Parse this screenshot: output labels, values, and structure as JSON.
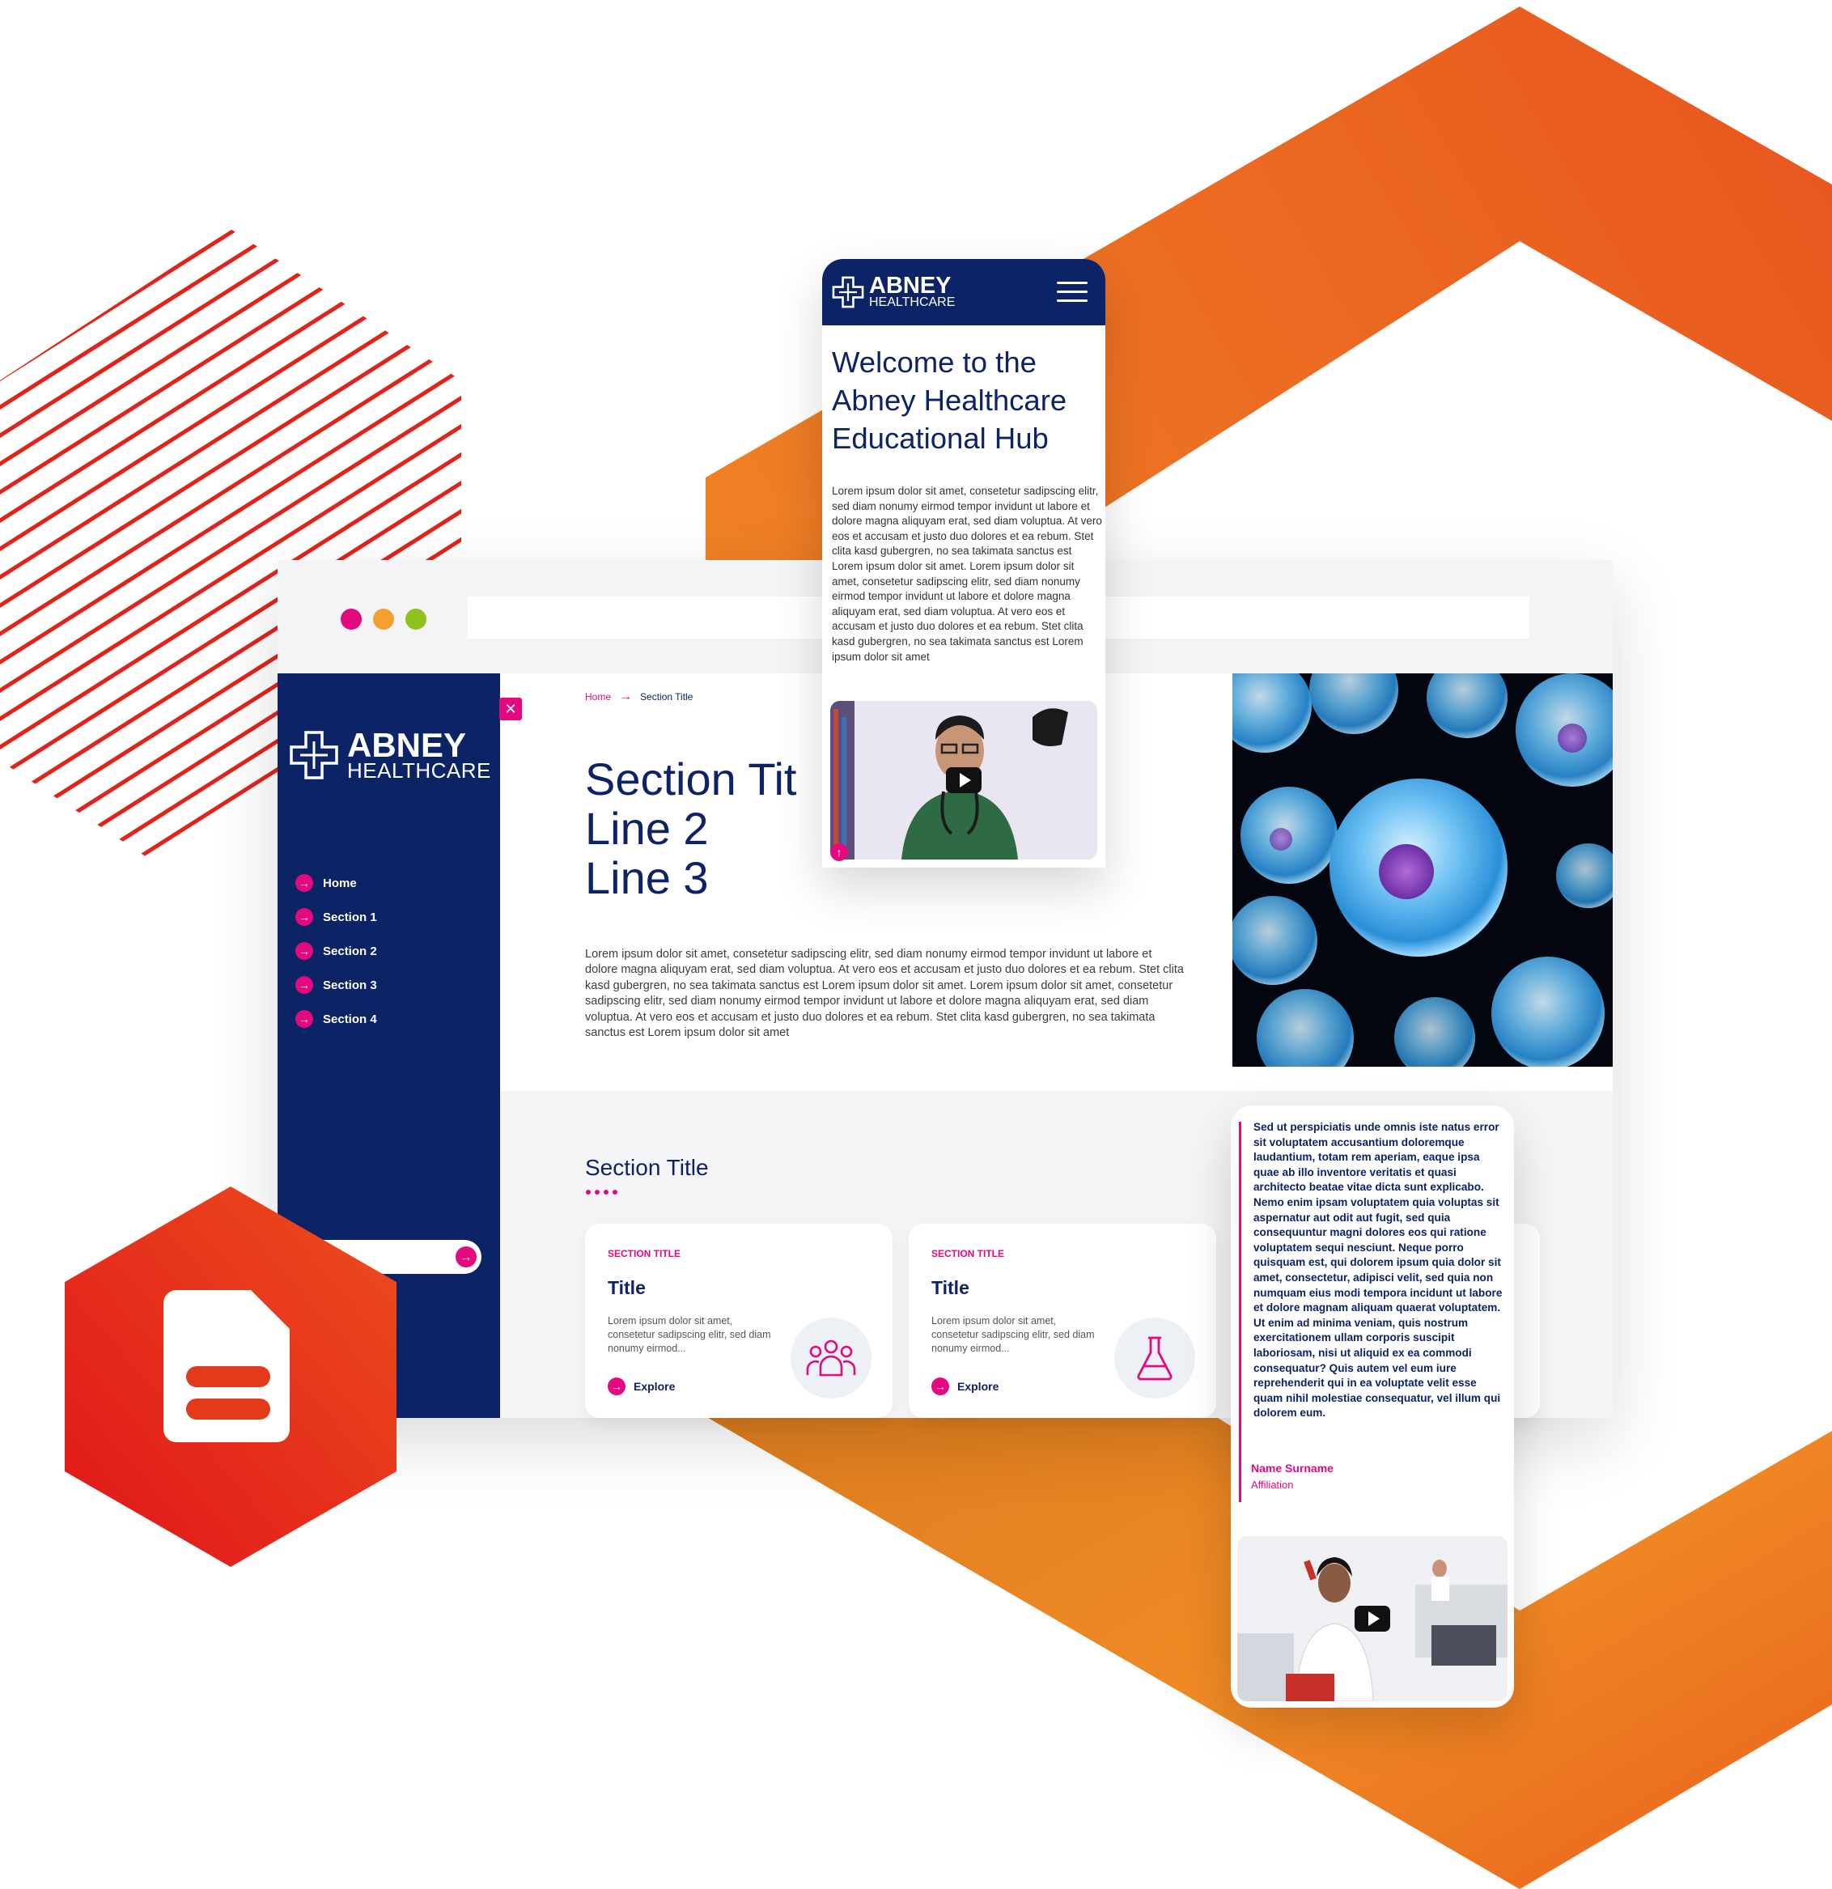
{
  "desktop": {
    "brand": {
      "name": "ABNEY",
      "sub": "HEALTHCARE"
    },
    "nav": [
      "Home",
      "Section 1",
      "Section 2",
      "Section 3",
      "Section 4"
    ],
    "breadcrumb": {
      "home": "Home",
      "current": "Section Title"
    },
    "hero": {
      "title_lines": [
        "Section Tit",
        "Line 2",
        "Line 3"
      ],
      "body": "Lorem ipsum dolor sit amet, consetetur sadipscing elitr, sed diam nonumy eirmod tempor invidunt ut labore et dolore magna aliquyam erat, sed diam voluptua. At vero eos et accusam et justo duo dolores et ea rebum. Stet clita kasd gubergren, no sea takimata sanctus est Lorem ipsum dolor sit amet. Lorem ipsum dolor sit amet, consetetur sadipscing elitr, sed diam nonumy eirmod tempor invidunt ut labore et dolore magna aliquyam erat, sed diam voluptua. At vero eos et accusam et justo duo dolores et ea rebum. Stet clita kasd gubergren, no sea takimata sanctus est Lorem ipsum dolor sit amet"
    },
    "section2": {
      "title": "Section Title",
      "cards": [
        {
          "kicker": "SECTION TITLE",
          "title": "Title",
          "body": "Lorem ipsum dolor sit amet, consetetur sadipscing elitr, sed diam nonumy eirmod...",
          "link": "Explore",
          "icon": "people-group-icon"
        },
        {
          "kicker": "SECTION TITLE",
          "title": "Title",
          "body": "Lorem ipsum dolor sit amet, consetetur sadipscing elitr, sed diam nonumy eirmod...",
          "link": "Explore",
          "icon": "flask-icon"
        }
      ]
    }
  },
  "mobile": {
    "brand": {
      "name": "ABNEY",
      "sub": "HEALTHCARE"
    },
    "title_lines": [
      "Welcome to the",
      "Abney Healthcare",
      "Educational Hub"
    ],
    "body": "Lorem ipsum dolor sit amet, consetetur sadipscing elitr, sed diam nonumy eirmod tempor invidunt ut labore et dolore magna aliquyam erat, sed diam voluptua. At vero eos et accusam et justo duo dolores et ea rebum. Stet clita kasd gubergren, no sea takimata sanctus est Lorem ipsum dolor sit amet. Lorem ipsum dolor sit amet, consetetur sadipscing elitr, sed diam nonumy eirmod tempor invidunt ut labore et dolore magna aliquyam erat, sed diam voluptua. At vero eos et accusam et justo duo dolores et ea rebum. Stet clita kasd gubergren, no sea takimata sanctus est Lorem ipsum dolor sit amet"
  },
  "testimonial": {
    "quote": "Sed ut perspiciatis unde omnis iste natus error sit voluptatem accusantium doloremque laudantium, totam rem aperiam, eaque ipsa quae ab illo inventore veritatis et quasi architecto beatae vitae dicta sunt explicabo. Nemo enim ipsam voluptatem quia voluptas sit aspernatur aut odit aut fugit, sed quia consequuntur magni dolores eos qui ratione voluptatem sequi nesciunt. Neque porro quisquam est, qui dolorem ipsum quia dolor sit amet, consectetur, adipisci velit, sed quia non numquam eius modi tempora incidunt ut labore et dolore magnam aliquam quaerat voluptatem. Ut enim ad minima veniam, quis nostrum exercitationem ullam corporis suscipit laboriosam, nisi ut aliquid ex ea commodi consequatur? Quis autem vel eum iure reprehenderit qui in ea voluptate velit esse quam nihil molestiae consequatur, vel illum qui dolorem eum.",
    "name": "Name Surname",
    "affiliation": "Affiliation"
  },
  "colors": {
    "navy": "#0c2366",
    "magenta": "#e5097f",
    "orange": "#ef7d1f",
    "red": "#e2231a",
    "dot_yellow": "#f2a12e",
    "dot_green": "#8dc21f"
  },
  "icons": [
    "document-icon",
    "hexagon-shape",
    "diagonal-stripes",
    "cross-logo-icon",
    "hamburger-menu-icon",
    "play-icon",
    "arrow-right-icon",
    "arrow-up-icon",
    "close-icon"
  ]
}
